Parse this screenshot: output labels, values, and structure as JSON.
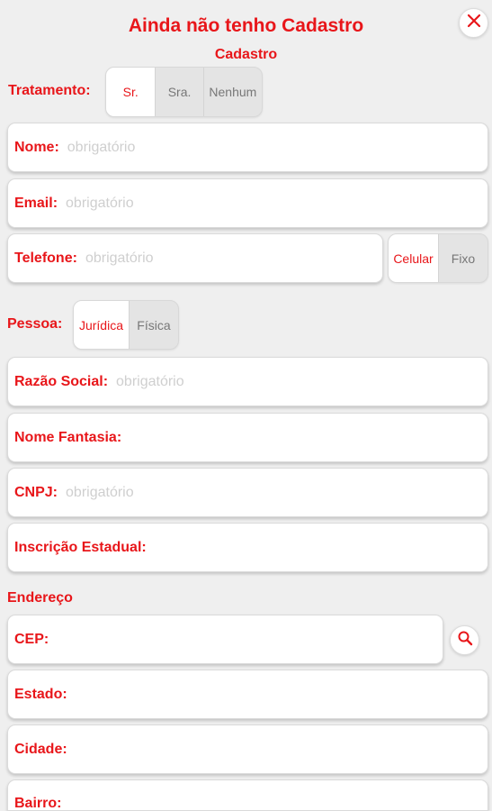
{
  "header": {
    "title": "Ainda não tenho Cadastro",
    "subtitle": "Cadastro"
  },
  "colors": {
    "accent": "#e8161a",
    "background": "#efefef"
  },
  "tratamento": {
    "label": "Tratamento:",
    "options": [
      "Sr.",
      "Sra.",
      "Nenhum"
    ],
    "selected": "Sr."
  },
  "nome": {
    "label": "Nome:",
    "placeholder": "obrigatório"
  },
  "email": {
    "label": "Email:",
    "placeholder": "obrigatório"
  },
  "telefone": {
    "label": "Telefone:",
    "placeholder": "obrigatório",
    "types": [
      "Celular",
      "Fixo"
    ],
    "selected": "Celular"
  },
  "pessoa": {
    "label": "Pessoa:",
    "options": [
      "Jurídica",
      "Física"
    ],
    "selected": "Jurídica"
  },
  "razao_social": {
    "label": "Razão Social:",
    "placeholder": "obrigatório"
  },
  "nome_fantasia": {
    "label": "Nome Fantasia:",
    "placeholder": ""
  },
  "cnpj": {
    "label": "CNPJ:",
    "placeholder": "obrigatório"
  },
  "inscricao_estadual": {
    "label": "Inscrição Estadual:",
    "placeholder": ""
  },
  "endereco": {
    "heading": "Endereço"
  },
  "cep": {
    "label": "CEP:",
    "placeholder": ""
  },
  "estado": {
    "label": "Estado:",
    "placeholder": ""
  },
  "cidade": {
    "label": "Cidade:",
    "placeholder": ""
  },
  "bairro": {
    "label": "Bairro:",
    "placeholder": ""
  },
  "icons": {
    "close": "close-icon",
    "search": "search-icon"
  }
}
